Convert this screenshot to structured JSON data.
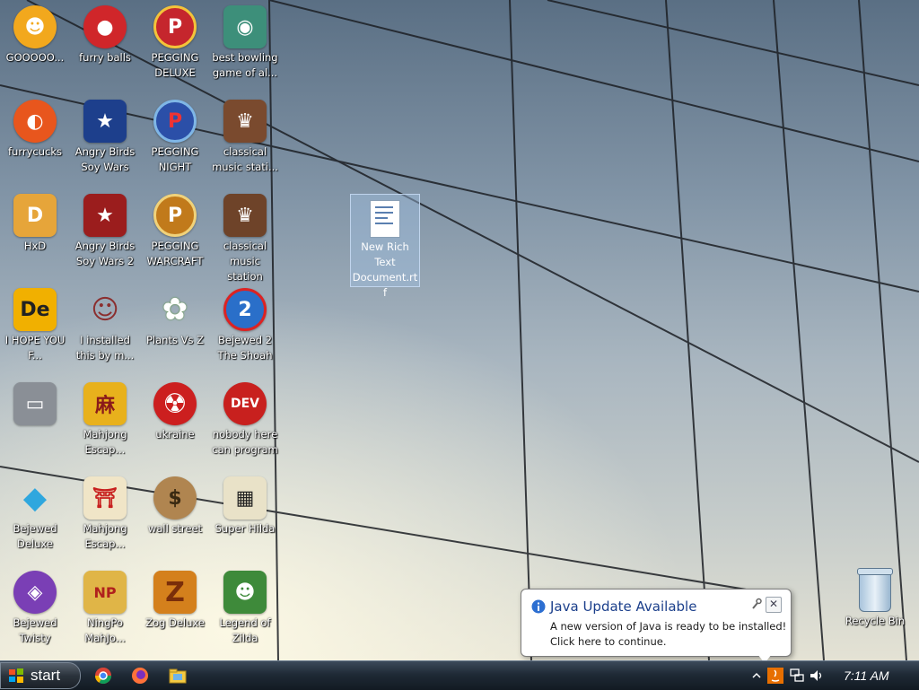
{
  "desktop": {
    "icons": [
      {
        "label": "GOOOOO...",
        "color": "#f2a81d"
      },
      {
        "label": "furry balls",
        "color": "#d0262a"
      },
      {
        "label": "PEGGING DELUXE",
        "color": "#c5262d"
      },
      {
        "label": "best bowling game of al...",
        "color": "#3d8f7a"
      },
      {
        "label": "furrycucks",
        "color": "#e8561d"
      },
      {
        "label": "Angry Birds Soy Wars",
        "color": "#1d3f8c"
      },
      {
        "label": "PEGGING NIGHT",
        "color": "#2b4fa8"
      },
      {
        "label": "classical music stati...",
        "color": "#7a4a2e"
      },
      {
        "label": "HxD",
        "color": "#e6a53a"
      },
      {
        "label": "Angry Birds Soy Wars 2",
        "color": "#9b1d1d"
      },
      {
        "label": "PEGGING WARCRAFT",
        "color": "#c17a1b"
      },
      {
        "label": "classical music station",
        "color": "#6e4329"
      },
      {
        "label": "I HOPE YOU F...",
        "color": "#f1b000"
      },
      {
        "label": "I installed this by m...",
        "color": "#8b2e2e"
      },
      {
        "label": "Plants Vs Z",
        "color": "#4f8f2e"
      },
      {
        "label": "Bejewed 2 The Shoah",
        "color": "#2a6fc9"
      },
      {
        "label": "",
        "color": "#8a8f96"
      },
      {
        "label": "Mahjong Escap...",
        "color": "#e8b11c"
      },
      {
        "label": "ukraine",
        "color": "#cc1f1f"
      },
      {
        "label": "nobody here can program",
        "color": "#c8201e"
      },
      {
        "label": "Bejewed Deluxe",
        "color": "#2fa7de"
      },
      {
        "label": "Mahjong Escap...",
        "color": "#f0e5c7"
      },
      {
        "label": "wall street",
        "color": "#b08550"
      },
      {
        "label": "Super Hilda",
        "color": "#e9e2c8"
      },
      {
        "label": "Bejewed Twisty",
        "color": "#7a3fb5"
      },
      {
        "label": "NingPo MahJo...",
        "color": "#e0b547"
      },
      {
        "label": "Zog Deluxe",
        "color": "#d4801c"
      },
      {
        "label": "Legend of Zilda",
        "color": "#3e8a3a"
      }
    ],
    "icon_glyphs": [
      "☻",
      "●",
      "P",
      "◉",
      "◐",
      "★",
      "P",
      "♛",
      "D",
      "★",
      "P",
      "♛",
      "De",
      "☺",
      "✿",
      "2",
      "▭",
      "麻",
      "☢",
      "DEV",
      "◆",
      "⛩",
      "$",
      "▦",
      "◈",
      "NP",
      "Z",
      "☻"
    ],
    "selected_file": {
      "label": "New Rich Text Document.rtf"
    },
    "recycle_bin": {
      "label": "Recycle Bin"
    }
  },
  "notification": {
    "title": "Java Update Available",
    "message_line1": "A new version of Java is ready to be installed!",
    "message_line2": "Click here to continue.",
    "close_glyph": "✕"
  },
  "taskbar": {
    "start_label": "start",
    "clock": "7:11 AM",
    "quick_launch": [
      "chrome-icon",
      "firefox-icon",
      "explorer-icon"
    ],
    "tray": [
      "show-hidden-icon",
      "java-icon",
      "network-icon",
      "volume-icon"
    ]
  }
}
